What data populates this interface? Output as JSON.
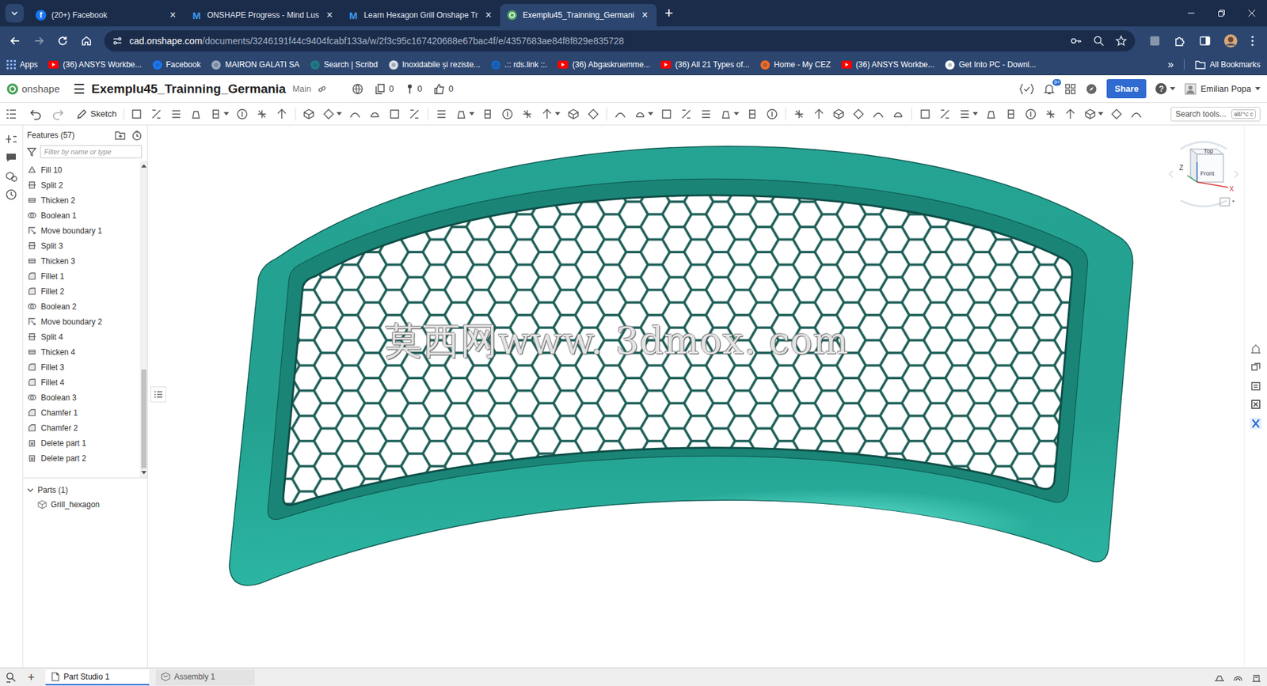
{
  "browser": {
    "tabs": [
      {
        "label": "(20+) Facebook",
        "icon": "facebook",
        "glyph": "f",
        "close": "×",
        "selected": false
      },
      {
        "label": "ONSHAPE Progress - Mind Lus",
        "icon": "mindluster",
        "glyph": "M",
        "close": "×",
        "selected": false
      },
      {
        "label": "Learn Hexagon Grill Onshape Tr",
        "icon": "mindluster",
        "glyph": "M",
        "close": "×",
        "selected": false
      },
      {
        "label": "Exemplu45_Trainning_Germani",
        "icon": "onshape",
        "close": "×",
        "selected": true
      }
    ],
    "new_tab": "+",
    "url_host": "cad.onshape.com",
    "url_path": "/documents/3246191f44c9404fcabf133a/w/2f3c95c167420688e67bac4f/e/4357683ae84f8f829e835728",
    "bookmarks": [
      {
        "label": "Apps",
        "icon": "apps"
      },
      {
        "label": "(36) ANSYS Workbe...",
        "icon": "youtube"
      },
      {
        "label": "Facebook",
        "icon": "facebook"
      },
      {
        "label": "MAIRON GALATI SA",
        "icon": "globe"
      },
      {
        "label": "Search | Scribd",
        "icon": "scribd"
      },
      {
        "label": "Inoxidabile și reziste...",
        "icon": "page"
      },
      {
        "label": ".:: rds.link ::.",
        "icon": "rds"
      },
      {
        "label": "(36) Abgaskruemme...",
        "icon": "youtube"
      },
      {
        "label": "(36) All 21 Types of...",
        "icon": "youtube"
      },
      {
        "label": "Home - My CEZ",
        "icon": "cez"
      },
      {
        "label": "(36) ANSYS Workbe...",
        "icon": "youtube"
      },
      {
        "label": "Get Into PC - Downl...",
        "icon": "google"
      }
    ],
    "more": "»",
    "all_bookmarks": "All Bookmarks"
  },
  "app": {
    "logo": "onshape",
    "menu": "☰",
    "document": "Exemplu45_Trainning_Germania",
    "branch": "Main",
    "stats": [
      {
        "icon": "copies",
        "count": "0"
      },
      {
        "icon": "pin",
        "count": "0"
      },
      {
        "icon": "like",
        "count": "0"
      }
    ],
    "notifications": "9+",
    "share": "Share",
    "help": "?",
    "user": "Emilian Popa"
  },
  "toolbar": {
    "sketch": "Sketch",
    "search_placeholder": "Search tools...",
    "shortcut": "alt/⌥ c"
  },
  "features": {
    "title": "Features (57)",
    "filter_placeholder": "Filter by name or type",
    "items": [
      {
        "label": "Fill 10",
        "kind": "fill"
      },
      {
        "label": "Split 2",
        "kind": "split"
      },
      {
        "label": "Thicken 2",
        "kind": "thicken"
      },
      {
        "label": "Boolean 1",
        "kind": "boolean"
      },
      {
        "label": "Move boundary 1",
        "kind": "move"
      },
      {
        "label": "Split 3",
        "kind": "split"
      },
      {
        "label": "Thicken 3",
        "kind": "thicken"
      },
      {
        "label": "Fillet 1",
        "kind": "fillet"
      },
      {
        "label": "Fillet 2",
        "kind": "fillet"
      },
      {
        "label": "Boolean 2",
        "kind": "boolean"
      },
      {
        "label": "Move boundary 2",
        "kind": "move"
      },
      {
        "label": "Split 4",
        "kind": "split"
      },
      {
        "label": "Thicken 4",
        "kind": "thicken"
      },
      {
        "label": "Fillet 3",
        "kind": "fillet"
      },
      {
        "label": "Fillet 4",
        "kind": "fillet"
      },
      {
        "label": "Boolean 3",
        "kind": "boolean"
      },
      {
        "label": "Chamfer 1",
        "kind": "chamfer"
      },
      {
        "label": "Chamfer 2",
        "kind": "chamfer"
      },
      {
        "label": "Delete part 1",
        "kind": "delete"
      },
      {
        "label": "Delete part 2",
        "kind": "delete"
      }
    ]
  },
  "parts": {
    "title": "Parts (1)",
    "expanded": true,
    "items": [
      "Grill_hexagon"
    ]
  },
  "viewport": {
    "watermark": "莫西网www. 3dmox. com",
    "view_cube": {
      "top": "Top",
      "front": "Front",
      "z": "Z",
      "x": "X"
    }
  },
  "bottom": {
    "add": "+",
    "tabs": [
      {
        "label": "Part Studio 1",
        "kind": "partstudio",
        "selected": true
      },
      {
        "label": "Assembly 1",
        "kind": "assembly",
        "selected": false
      }
    ]
  }
}
